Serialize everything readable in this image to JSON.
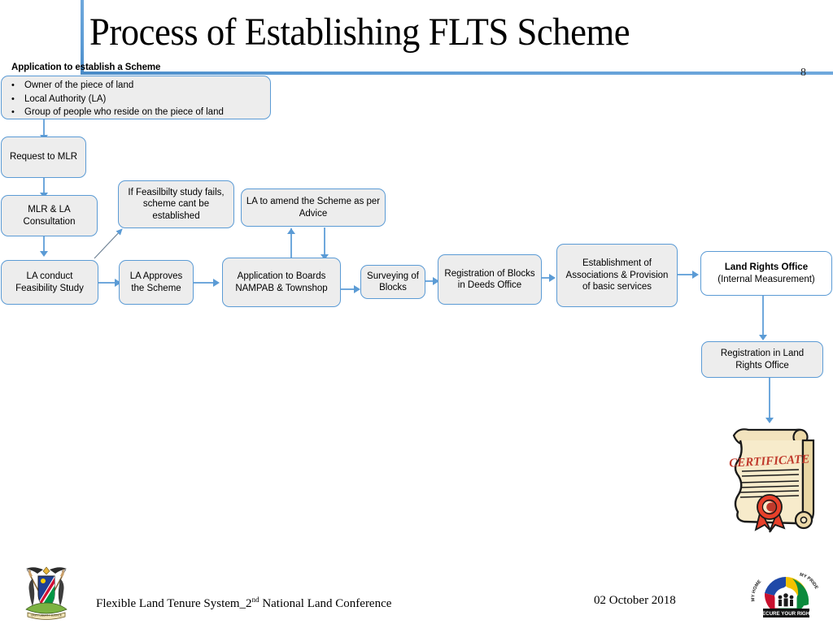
{
  "slide": {
    "title": "Process of Establishing FLTS Scheme",
    "number": "8",
    "accent_color": "#5B9BD5",
    "box_fill": "#EDEDED",
    "box_border": "#5B9BD5"
  },
  "section": {
    "heading": "Application to establish a Scheme",
    "applicants": [
      "Owner of the piece of land",
      "Local Authority (LA)",
      "Group of people who reside on the piece of land"
    ]
  },
  "flow": {
    "request_mlr": "Request to MLR",
    "mlr_la_consultation": "MLR & LA Consultation",
    "la_feasibility": "LA conduct Feasibility Study",
    "feasibility_fails": "If Feasilbilty study fails, scheme cant be established",
    "la_approves": "LA Approves the Scheme",
    "la_amend": "LA to amend the Scheme as per Advice",
    "application_boards": "Application to Boards NAMPAB & Townshop",
    "surveying_blocks": "Surveying of Blocks",
    "registration_deeds": "Registration of Blocks in Deeds Office",
    "establishment_assoc": "Establishment of Associations & Provision of basic services",
    "land_rights_office_title": "Land Rights Office",
    "land_rights_office_sub": "(Internal Measurement)",
    "registration_lro": "Registration in Land Rights Office"
  },
  "certificate": {
    "label": "CERTIFICATE"
  },
  "footer": {
    "conference": "Flexible Land Tenure System_2",
    "conference_sup": "nd",
    "conference_rest": " National Land Conference",
    "date": "02 October 2018",
    "logo_motto_left": "MY HOME",
    "logo_motto_right": "MY PRIDE",
    "logo_banner": "SECURE YOUR RIGHT."
  }
}
